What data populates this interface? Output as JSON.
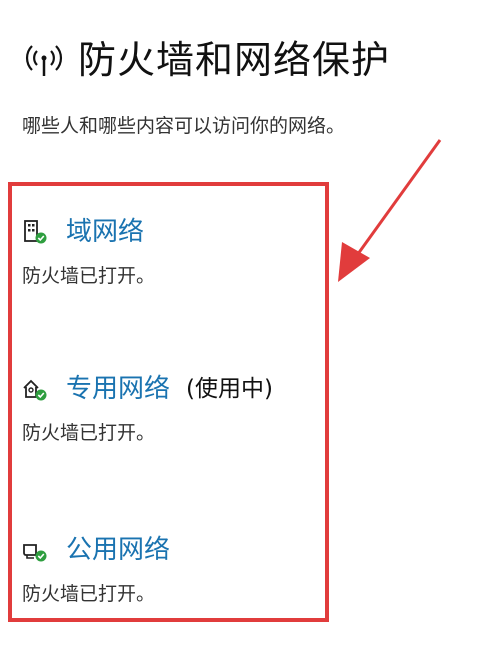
{
  "header": {
    "icon": "wifi-antenna-icon",
    "title": "防火墙和网络保护"
  },
  "subtitle": "哪些人和哪些内容可以访问你的网络。",
  "networks": [
    {
      "icon": "domain-network-icon",
      "name": "域网络",
      "note": "",
      "status": "防火墙已打开。"
    },
    {
      "icon": "private-network-icon",
      "name": "专用网络",
      "note": "(使用中)",
      "status": "防火墙已打开。"
    },
    {
      "icon": "public-network-icon",
      "name": "公用网络",
      "note": "",
      "status": "防火墙已打开。"
    }
  ],
  "colors": {
    "link": "#1a73b0",
    "annotation": "#e13c3c",
    "check": "#2e9e3f"
  }
}
